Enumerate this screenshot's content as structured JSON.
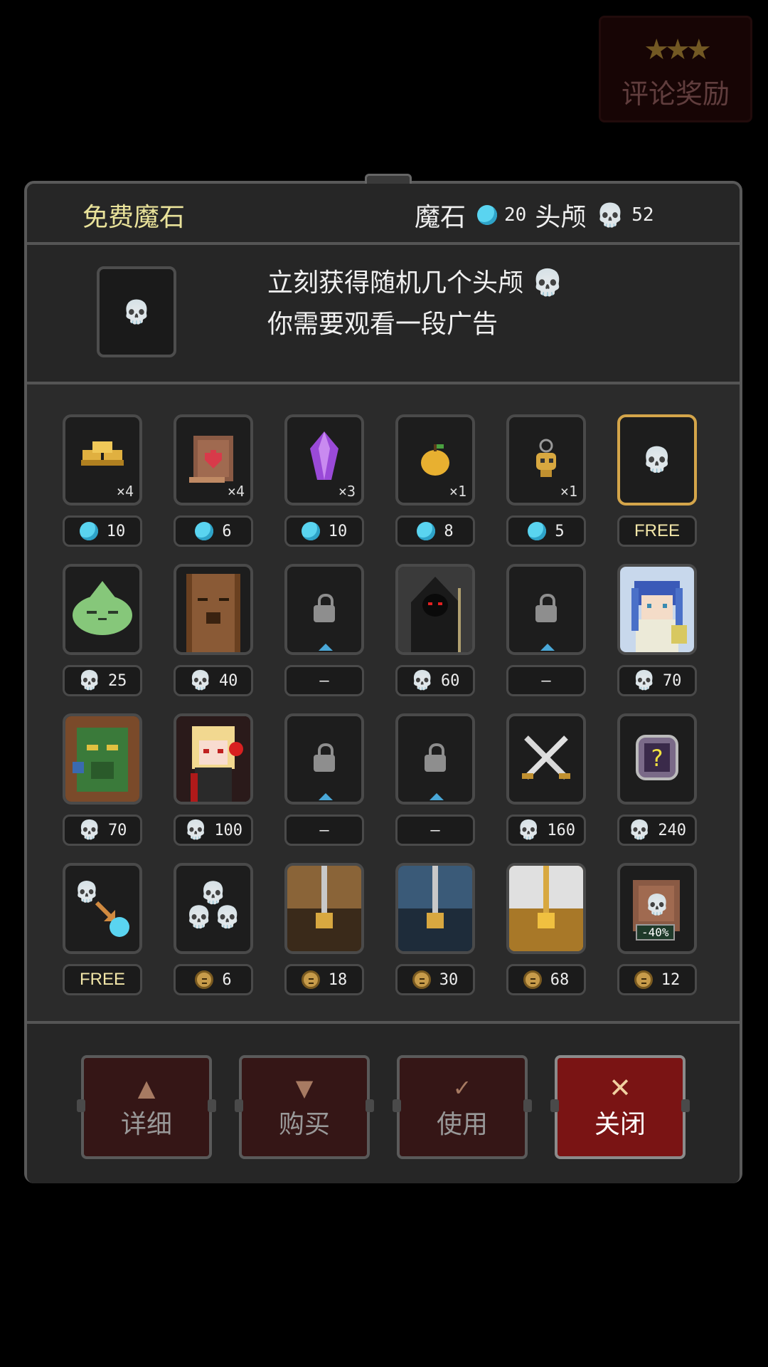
{
  "review": {
    "stars": "★★★",
    "label": "评论奖励"
  },
  "header": {
    "title": "免费魔石",
    "gem_label": "魔石",
    "gems": "20",
    "skull_label": "头颅",
    "skulls": "52"
  },
  "description": {
    "line1": "立刻获得随机几个头颅 💀",
    "line2": "你需要观看一段广告"
  },
  "shop": {
    "rows": [
      [
        {
          "art": "gold-bars",
          "qty": "×4",
          "price_icon": "gem",
          "price": "10"
        },
        {
          "art": "heart-scroll",
          "qty": "×4",
          "price_icon": "gem",
          "price": "6"
        },
        {
          "art": "purple-crystal",
          "qty": "×3",
          "price_icon": "gem",
          "price": "10"
        },
        {
          "art": "golden-apple",
          "qty": "×1",
          "price_icon": "gem",
          "price": "8"
        },
        {
          "art": "skull-amulet",
          "qty": "×1",
          "price_icon": "gem",
          "price": "5"
        },
        {
          "art": "skull",
          "qty": "",
          "price_icon": "none",
          "price": "FREE",
          "selected": true
        }
      ],
      [
        {
          "art": "green-slime",
          "qty": "",
          "price_icon": "skull",
          "price": "25"
        },
        {
          "art": "tree-ent",
          "qty": "",
          "price_icon": "skull",
          "price": "40"
        },
        {
          "art": "locked",
          "qty": "",
          "price_icon": "none",
          "price": "—"
        },
        {
          "art": "hooded-reaper",
          "qty": "",
          "price_icon": "skull",
          "price": "60"
        },
        {
          "art": "locked",
          "qty": "",
          "price_icon": "none",
          "price": "—"
        },
        {
          "art": "elf-mage",
          "qty": "",
          "price_icon": "skull",
          "price": "70"
        }
      ],
      [
        {
          "art": "forest-guardian",
          "qty": "",
          "price_icon": "skull",
          "price": "70"
        },
        {
          "art": "vampire-girl",
          "qty": "",
          "price_icon": "skull",
          "price": "100"
        },
        {
          "art": "locked",
          "qty": "",
          "price_icon": "none",
          "price": "—"
        },
        {
          "art": "locked",
          "qty": "",
          "price_icon": "none",
          "price": "—"
        },
        {
          "art": "crossed-swords",
          "qty": "",
          "price_icon": "skull",
          "price": "160"
        },
        {
          "art": "mystery-box",
          "qty": "",
          "price_icon": "skull",
          "price": "240"
        }
      ],
      [
        {
          "art": "skull-to-gem",
          "qty": "",
          "price_icon": "none",
          "price": "FREE"
        },
        {
          "art": "skull-pile",
          "qty": "",
          "price_icon": "coin",
          "price": "6"
        },
        {
          "art": "brown-chest",
          "qty": "",
          "price_icon": "coin",
          "price": "18"
        },
        {
          "art": "blue-chest",
          "qty": "",
          "price_icon": "coin",
          "price": "30"
        },
        {
          "art": "gold-chest",
          "qty": "",
          "price_icon": "coin",
          "price": "68"
        },
        {
          "art": "discount-scroll",
          "qty": "",
          "price_icon": "coin",
          "price": "12",
          "badge": "-40%"
        }
      ]
    ]
  },
  "buttons": {
    "detail": "详细",
    "buy": "购买",
    "use": "使用",
    "close": "关闭"
  },
  "colors": {
    "accent_gold": "#d4a54a",
    "gem": "#5ad4f0",
    "close_button": "#7a1414"
  }
}
